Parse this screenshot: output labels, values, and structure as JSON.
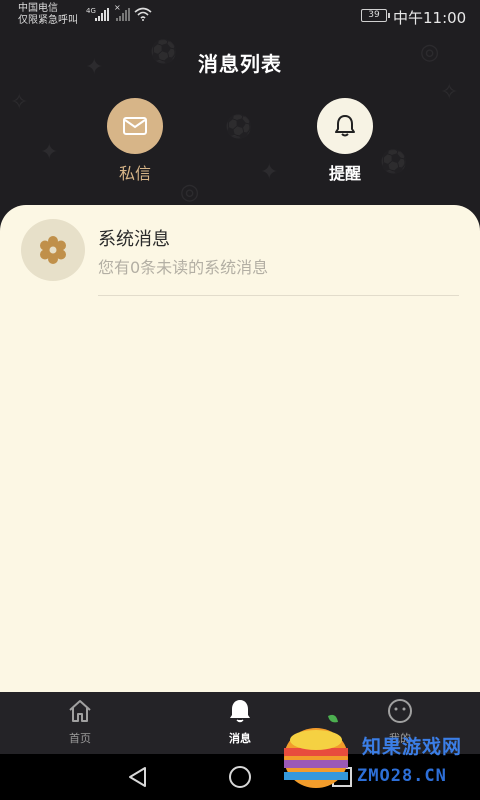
{
  "status_bar": {
    "carrier_line1": "中国电信",
    "carrier_line2": "仅限紧急呼叫",
    "network": "4G",
    "battery": "39",
    "time": "中午11:00"
  },
  "header": {
    "title": "消息列表",
    "private_message": {
      "label": "私信",
      "icon": "envelope-icon"
    },
    "reminder": {
      "label": "提醒",
      "icon": "bell-icon"
    }
  },
  "messages": [
    {
      "icon": "gear-icon",
      "title": "系统消息",
      "subtitle": "您有0条未读的系统消息"
    }
  ],
  "tab_bar": {
    "items": [
      {
        "label": "首页",
        "icon": "home-icon",
        "active": false
      },
      {
        "label": "消息",
        "icon": "bell-icon",
        "active": true
      },
      {
        "label": "我的",
        "icon": "smiley-icon",
        "active": false
      }
    ]
  },
  "nav_bar": {
    "back": "back-triangle-icon",
    "home": "home-circle-icon",
    "recent": "recent-square-icon"
  },
  "watermark": {
    "line1": "知果游戏网",
    "line2": "ZMO28.CN"
  },
  "colors": {
    "background": "#1f1e21",
    "panel": "#fcf7e4",
    "accent_gold": "#d7b588",
    "remind_circle": "#f7f3e4",
    "gear": "#c0904a"
  }
}
